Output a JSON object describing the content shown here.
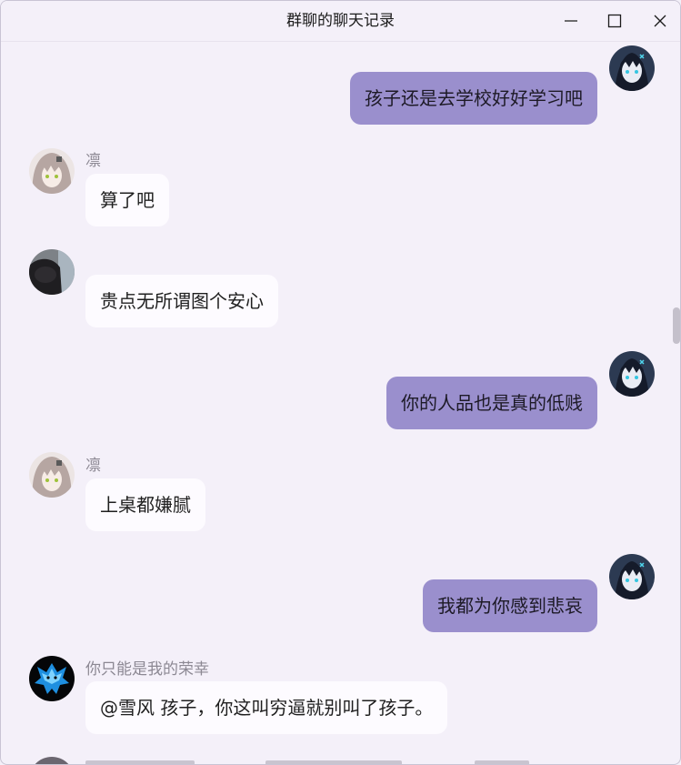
{
  "window": {
    "title": "群聊的聊天记录"
  },
  "controls": {
    "minimize_icon": "minimize-icon",
    "maximize_icon": "maximize-icon",
    "close_icon": "close-icon"
  },
  "colors": {
    "background": "#f4f0f9",
    "own_bubble": "#9a8fcd",
    "other_bubble": "#fdfbff",
    "sender_name": "#8c8893"
  },
  "messages": [
    {
      "side": "right",
      "sender": "",
      "text": "孩子还是去学校好好学习吧"
    },
    {
      "side": "left",
      "sender": "凛",
      "text": "算了吧"
    },
    {
      "side": "left",
      "sender": "",
      "text": "贵点无所谓图个安心"
    },
    {
      "side": "right",
      "sender": "",
      "text": "你的人品也是真的低贱"
    },
    {
      "side": "left",
      "sender": "凛",
      "text": "上桌都嫌腻"
    },
    {
      "side": "right",
      "sender": "",
      "text": "我都为你感到悲哀"
    },
    {
      "side": "left",
      "sender": "你只能是我的荣幸",
      "text": "@雪风 孩子，你这叫穷逼就别叫了孩子。"
    }
  ]
}
